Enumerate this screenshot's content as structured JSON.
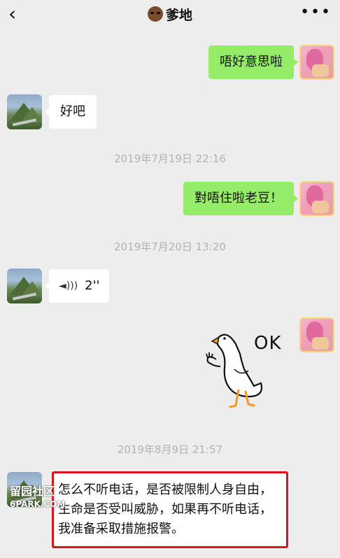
{
  "nav": {
    "back_glyph": "‹",
    "title": "爹地",
    "more_glyph": "•••"
  },
  "messages": {
    "m1": "唔好意思啦",
    "m2": "好吧",
    "t1": "2019年7月19日 22:16",
    "m3": "對唔住啦老豆！",
    "t2": "2019年7月20日 13:20",
    "voice_duration": "2''",
    "sticker_text": "OK",
    "t3": "2019年8月9日 21:57",
    "m4": "怎么不听电话，是否被限制人身自由，生命是否受叫威胁，如果再不听电话，我准备采取措施报警。"
  },
  "watermark": {
    "line1": "留园社区",
    "line2": "6PARK.COM"
  },
  "colors": {
    "background": "#ededed",
    "sent_bubble": "#95ec69",
    "received_bubble": "#ffffff",
    "highlight_border": "#d9141c",
    "timestamp": "#b2b2b2"
  }
}
